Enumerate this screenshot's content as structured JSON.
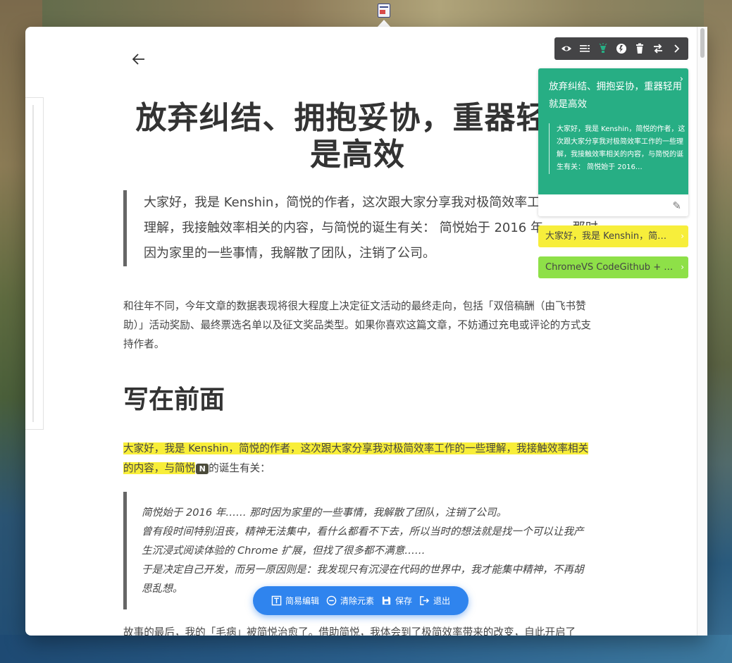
{
  "article": {
    "back_icon": "arrow-left-icon",
    "title_line1": "放弃纠结、拥抱妥协，重器轻用",
    "title_line2": "是高效",
    "lead": "大家好，我是 Kenshin，简悦的作者，这次跟大家分享我对极简效率工作的一些理解，我接触效率相关的内容，与简悦的诞生有关：  简悦始于 2016 年…… 那时因为家里的一些事情，我解散了团队，注销了公司。",
    "para1": "和往年不同，今年文章的数据表现将很大程度上决定征文活动的最终走向，包括「双倍稿酬（由飞书赞助）」活动奖励、最终票选名单以及征文奖品类型。如果你喜欢这篇文章，不妨通过充电或评论的方式支持作者。",
    "heading": "写在前面",
    "para2_highlight_a": "大家好，我是 Kenshin，简悦的作者，这次跟大家分享我对极简效率工作的一些理解，我接触效率相关的内容，与简悦",
    "para2_badge": "N",
    "para2_rest": "的诞生有关：",
    "quote_lines": [
      "简悦始于 2016 年…… 那时因为家里的一些事情，我解散了团队，注销了公司。",
      "曾有段时间特别沮丧，精神无法集中，看什么都看不下去，所以当时的想法就是找一个可以让我产生沉浸式阅读体验的 Chrome 扩展，但找了很多都不满意……",
      "于是决定自己开发，而另一原因则是：我发现只有沉浸在代码的世界中，我才能集中精神，不再胡思乱想。"
    ],
    "para3": "故事的最后，我的「毛病」被简悦治愈了。借助简悦，我体会到了极简效率带来的改变，自此开启了"
  },
  "toolbar": {
    "icons": [
      "eye-icon",
      "list-icon",
      "bulb-icon",
      "export-icon",
      "trash-icon",
      "swap-icon",
      "chevron-right-icon"
    ]
  },
  "note": {
    "title": "放弃纠结、拥抱妥协，重器轻用就是高效",
    "body": "大家好，我是 Kenshin，简悦的作者，这次跟大家分享我对极简效率工作的一些理解，我接触效率相关的内容，与简悦的诞生有关： 简悦始于 2016…",
    "color": "#27ae84"
  },
  "highlights": [
    {
      "text": "大家好，我是 Kenshin，简悦…",
      "color": "#f7ee3b"
    },
    {
      "text": "ChromeVS CodeGithub + g…",
      "color": "#8ee048"
    }
  ],
  "bottom_bar": {
    "simple_edit": "简易编辑",
    "clear_elements": "清除元素",
    "save": "保存",
    "exit": "退出",
    "color": "#2f84ee"
  }
}
